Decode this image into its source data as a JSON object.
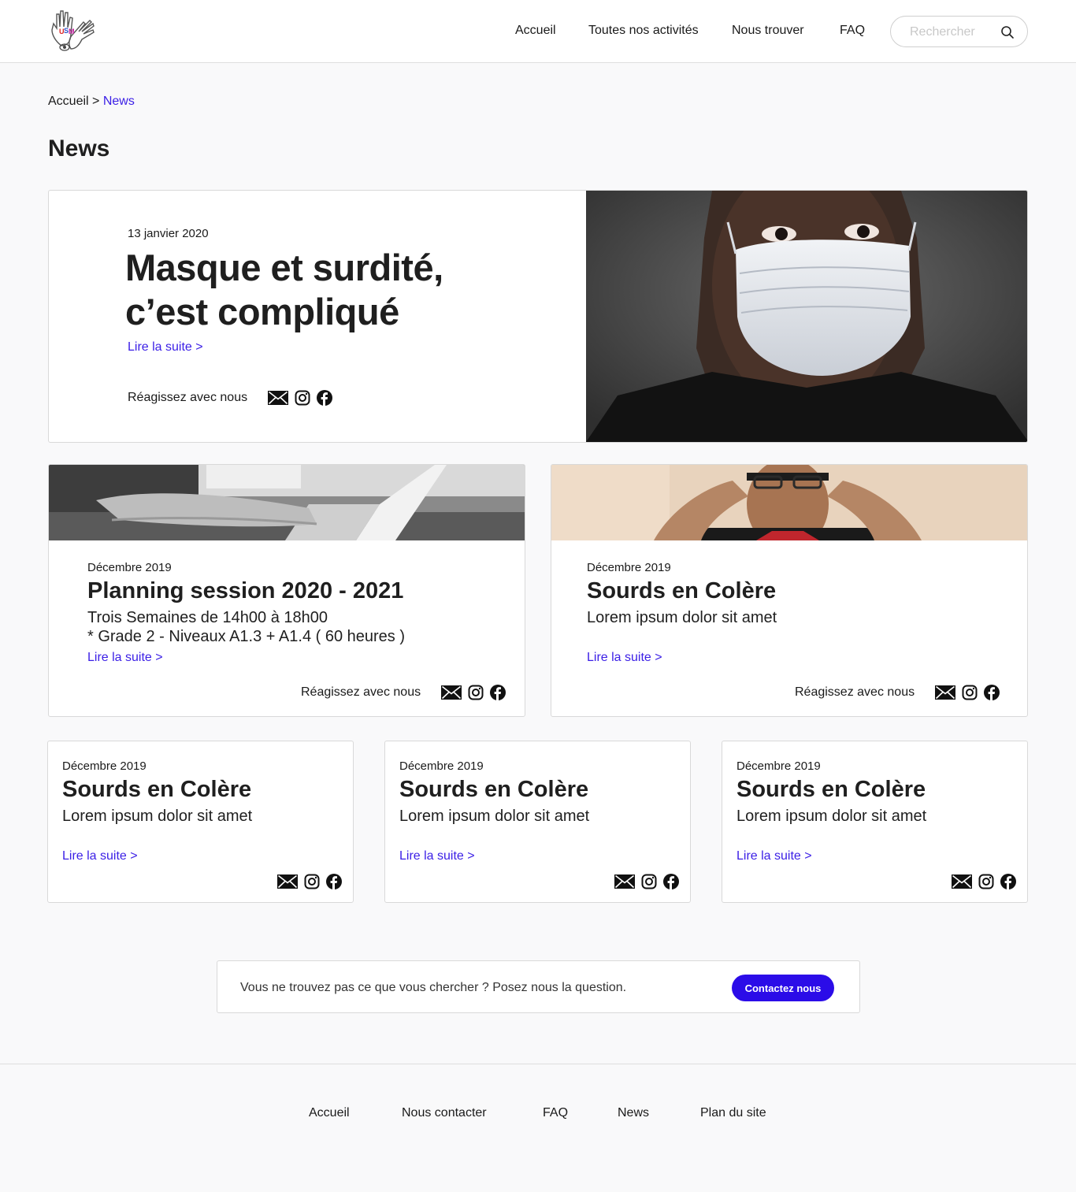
{
  "header": {
    "nav": [
      "Accueil",
      "Toutes nos activités",
      "Nous trouver",
      "FAQ"
    ],
    "search_placeholder": "Rechercher",
    "search_icon": "magnifier-icon"
  },
  "breadcrumb": {
    "home": "Accueil",
    "separator": ">",
    "current": "News"
  },
  "page": {
    "title": "News"
  },
  "featured": {
    "date": "13 janvier 2020",
    "title_line1": "Masque et surdité,",
    "title_line2": "c’est compliqué",
    "read_more": "Lire la suite >",
    "react_label": "Réagissez avec nous",
    "image": "woman-wearing-surgical-mask-photo"
  },
  "mid_cards": [
    {
      "date": "Décembre 2019",
      "title": "Planning session 2020 - 2021",
      "sub1": "Trois Semaines de 14h00 à 18h00",
      "sub2": "* Grade 2 - Niveaux A1.3 + A1.4 ( 60 heures )",
      "read_more": "Lire la suite >",
      "react_label": "Réagissez avec nous",
      "image": "hands-typing-laptop-photo"
    },
    {
      "date": "Décembre 2019",
      "title": "Sourds en Colère",
      "sub1": "Lorem ipsum dolor sit amet",
      "read_more": "Lire la suite >",
      "react_label": "Réagissez avec nous",
      "image": "man-signing-photo"
    }
  ],
  "small_cards": [
    {
      "date": "Décembre 2019",
      "title": "Sourds en Colère",
      "sub1": "Lorem ipsum dolor sit amet",
      "read_more": "Lire la suite >"
    },
    {
      "date": "Décembre 2019",
      "title": "Sourds en Colère",
      "sub1": "Lorem ipsum dolor sit amet",
      "read_more": "Lire la suite >"
    },
    {
      "date": "Décembre 2019",
      "title": "Sourds en Colère",
      "sub1": "Lorem ipsum dolor sit amet",
      "read_more": "Lire la suite >"
    }
  ],
  "share_icons": [
    "mail-icon",
    "instagram-icon",
    "facebook-icon"
  ],
  "contact": {
    "text": "Vous ne trouvez pas ce que vous chercher ? Posez nous la question.",
    "button": "Contactez nous",
    "button_color": "#2b0ce8"
  },
  "footer": {
    "links": [
      "Accueil",
      "Nous contacter",
      "FAQ",
      "News",
      "Plan du site"
    ]
  },
  "colors": {
    "accent": "#3a1ee6",
    "background": "#f9f9fa",
    "text": "#1f1f1f"
  }
}
